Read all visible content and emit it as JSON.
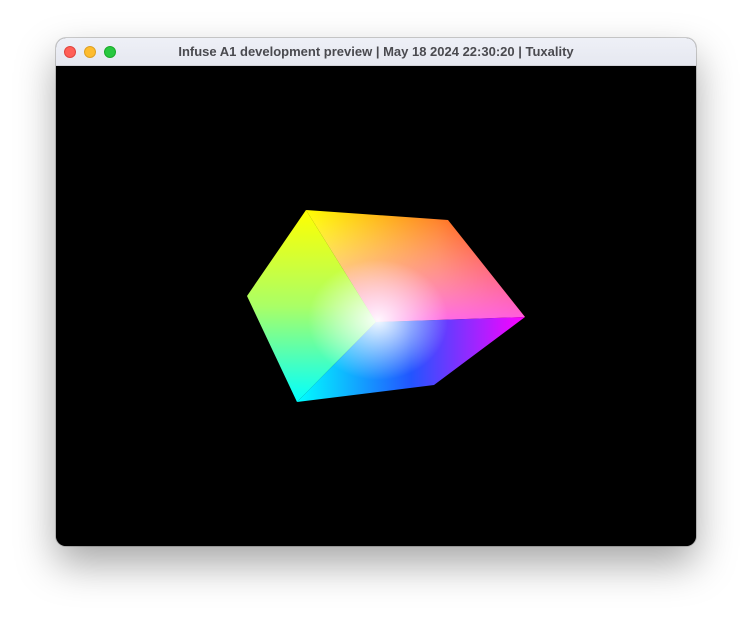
{
  "window": {
    "title": "Infuse A1 development preview | May 18 2024 22:30:20 | Tuxality"
  },
  "traffic_lights": {
    "close": {
      "icon": "close-icon",
      "color": "#ff5f57"
    },
    "minimize": {
      "icon": "minimize-icon",
      "color": "#febc2e"
    },
    "maximize": {
      "icon": "maximize-icon",
      "color": "#28c840"
    }
  },
  "viewport": {
    "background": "#000000",
    "scene": "rgb-color-cube"
  }
}
